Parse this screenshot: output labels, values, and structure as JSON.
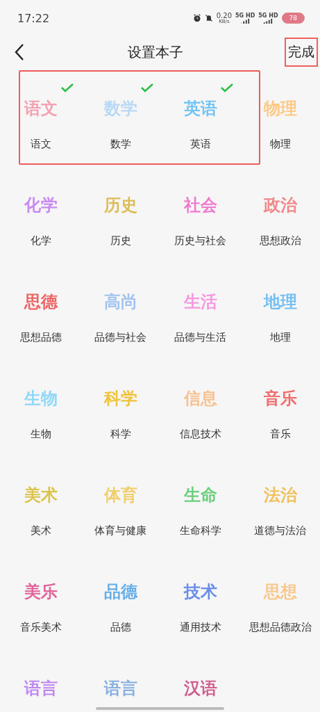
{
  "status_bar": {
    "time": "17:22",
    "speed": "0.20",
    "speed_unit": "KB/s",
    "network_1": "5G HD",
    "network_2": "5G HD",
    "battery": "78"
  },
  "header": {
    "title": "设置本子",
    "done": {
      "label": "完成",
      "highlighted": true
    }
  },
  "subjects": [
    {
      "cover": "语文",
      "label": "语文",
      "color": "#f4a0b0",
      "selected": true
    },
    {
      "cover": "数学",
      "label": "数学",
      "color": "#b9d9f5",
      "selected": true
    },
    {
      "cover": "英语",
      "label": "英语",
      "color": "#72c4f4",
      "selected": true
    },
    {
      "cover": "物理",
      "label": "物理",
      "color": "#fdc884",
      "selected": false
    },
    {
      "cover": "化学",
      "label": "化学",
      "color": "#c98af2",
      "selected": false
    },
    {
      "cover": "历史",
      "label": "历史",
      "color": "#dcbd5a",
      "selected": false
    },
    {
      "cover": "社会",
      "label": "历史与社会",
      "color": "#f07ad0",
      "selected": false
    },
    {
      "cover": "政治",
      "label": "思想政治",
      "color": "#f0888a",
      "selected": false
    },
    {
      "cover": "思德",
      "label": "思想品德",
      "color": "#ee6464",
      "selected": false
    },
    {
      "cover": "高尚",
      "label": "品德与社会",
      "color": "#a2c2f0",
      "selected": false
    },
    {
      "cover": "生活",
      "label": "品德与生活",
      "color": "#f598e0",
      "selected": false
    },
    {
      "cover": "地理",
      "label": "地理",
      "color": "#74bff0",
      "selected": false
    },
    {
      "cover": "生物",
      "label": "生物",
      "color": "#8ed8f8",
      "selected": false
    },
    {
      "cover": "科学",
      "label": "科学",
      "color": "#f0c23a",
      "selected": false
    },
    {
      "cover": "信息",
      "label": "信息技术",
      "color": "#f8c090",
      "selected": false
    },
    {
      "cover": "音乐",
      "label": "音乐",
      "color": "#f06e6e",
      "selected": false
    },
    {
      "cover": "美术",
      "label": "美术",
      "color": "#dcc44c",
      "selected": false
    },
    {
      "cover": "体育",
      "label": "体育与健康",
      "color": "#f0d06a",
      "selected": false
    },
    {
      "cover": "生命",
      "label": "生命科学",
      "color": "#6cd07e",
      "selected": false
    },
    {
      "cover": "法治",
      "label": "道德与法治",
      "color": "#f0c05c",
      "selected": false
    },
    {
      "cover": "美乐",
      "label": "音乐美术",
      "color": "#e0649a",
      "selected": false
    },
    {
      "cover": "品德",
      "label": "品德",
      "color": "#66aee8",
      "selected": false
    },
    {
      "cover": "技术",
      "label": "通用技术",
      "color": "#6a8ee8",
      "selected": false
    },
    {
      "cover": "思想",
      "label": "思想品德政治",
      "color": "#f8c88e",
      "selected": false
    },
    {
      "cover": "语言",
      "color": "#c088f2",
      "selected": false
    },
    {
      "cover": "语言",
      "color": "#88b0e0",
      "selected": false
    },
    {
      "cover": "汉语",
      "color": "#d06090",
      "selected": false
    }
  ]
}
